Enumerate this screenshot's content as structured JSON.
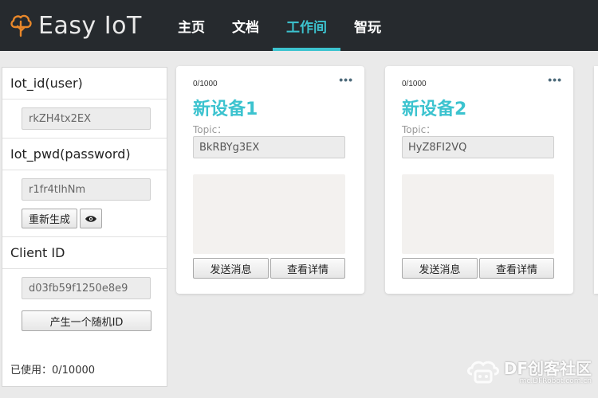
{
  "app": {
    "brand_name": "Easy IoT",
    "logo_icon": "cloud-tree-logo-icon",
    "accent_color": "#3cc3cf"
  },
  "nav": {
    "items": [
      {
        "label": "主页",
        "active": false
      },
      {
        "label": "文档",
        "active": false
      },
      {
        "label": "工作间",
        "active": true
      },
      {
        "label": "智玩",
        "active": false
      }
    ]
  },
  "sidebar": {
    "user_title": "Iot_id(user)",
    "user_value": "rkZH4tx2EX",
    "pwd_title": "Iot_pwd(password)",
    "pwd_value": "r1fr4tlhNm",
    "regen_label": "重新生成",
    "eye_icon": "eye-icon",
    "client_title": "Client ID",
    "client_value": "d03fb59f1250e8e9",
    "random_label": "产生一个随机ID",
    "used_label": "已使用：0/10000"
  },
  "devices": [
    {
      "count": "0/1000",
      "more": "•••",
      "name": "新设备1",
      "topic_label": "Topic：",
      "topic": "BkRBYg3EX",
      "send_label": "发送消息",
      "detail_label": "查看详情"
    },
    {
      "count": "0/1000",
      "more": "•••",
      "name": "新设备2",
      "topic_label": "Topic：",
      "topic": "HyZ8FI2VQ",
      "send_label": "发送消息",
      "detail_label": "查看详情"
    }
  ],
  "watermark": {
    "main": "DF创客社区",
    "sub": "mc.DFRobot.com.cn"
  }
}
